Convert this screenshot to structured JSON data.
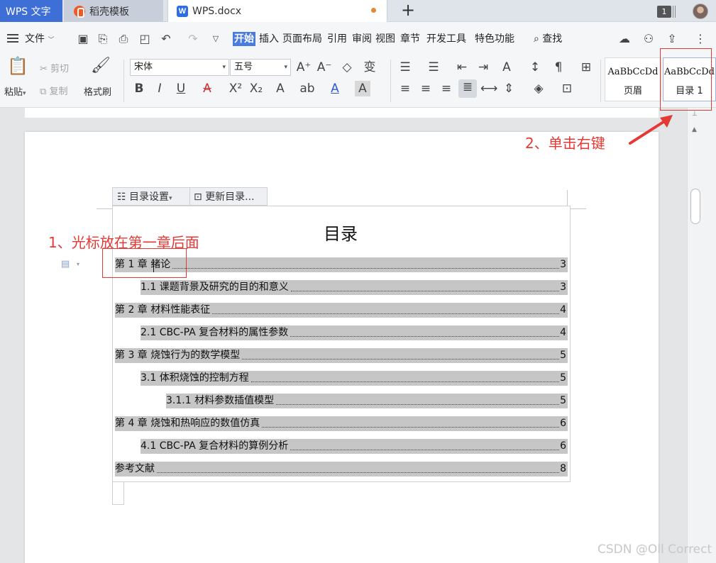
{
  "tabs": {
    "app": "WPS 文字",
    "templates": "稻壳模板",
    "document": "WPS.docx",
    "new_tab": "+",
    "page_count": "1"
  },
  "menu": {
    "file": "文件",
    "items": [
      "开始",
      "插入",
      "页面布局",
      "引用",
      "审阅",
      "视图",
      "章节",
      "开发工具",
      "特色功能"
    ],
    "search": "查找"
  },
  "ribbon": {
    "paste": "粘贴",
    "cut": "剪切",
    "copy": "复制",
    "format_painter": "格式刷",
    "font_name": "宋体",
    "font_size": "五号",
    "style_cards": [
      {
        "sample": "AaBbCcDd",
        "label": "页眉"
      },
      {
        "sample": "AaBbCcDd",
        "label": "目录 1"
      }
    ]
  },
  "toc_toolbar": {
    "settings": "目录设置",
    "update": "更新目录..."
  },
  "toc": {
    "title": "目录",
    "entries": [
      {
        "text": "第 1 章  绪论",
        "page": "3",
        "level": 1
      },
      {
        "text": "1.1 课题背景及研究的目的和意义",
        "page": "3",
        "level": 2
      },
      {
        "text": "第 2 章  材料性能表征",
        "page": "4",
        "level": 1
      },
      {
        "text": "2.1  CBC-PA 复合材料的属性参数",
        "page": "4",
        "level": 2
      },
      {
        "text": "第 3 章  烧蚀行为的数学模型",
        "page": "5",
        "level": 1
      },
      {
        "text": "3.1 体积烧蚀的控制方程",
        "page": "5",
        "level": 2
      },
      {
        "text": "3.1.1 材料参数插值模型",
        "page": "5",
        "level": 3
      },
      {
        "text": "第 4 章  烧蚀和热响应的数值仿真",
        "page": "6",
        "level": 1
      },
      {
        "text": "4.1  CBC-PA 复合材料的算例分析",
        "page": "6",
        "level": 2
      },
      {
        "text": "参考文献",
        "page": "8",
        "level": 1
      }
    ]
  },
  "annotations": {
    "step1": "1、光标放在第一章后面",
    "step2": "2、单击右键"
  },
  "watermark": "CSDN @Oll Correct",
  "colors": {
    "accent": "#3d6fd6",
    "annotation": "#e53935",
    "toc_highlight": "#c6c6c6"
  }
}
